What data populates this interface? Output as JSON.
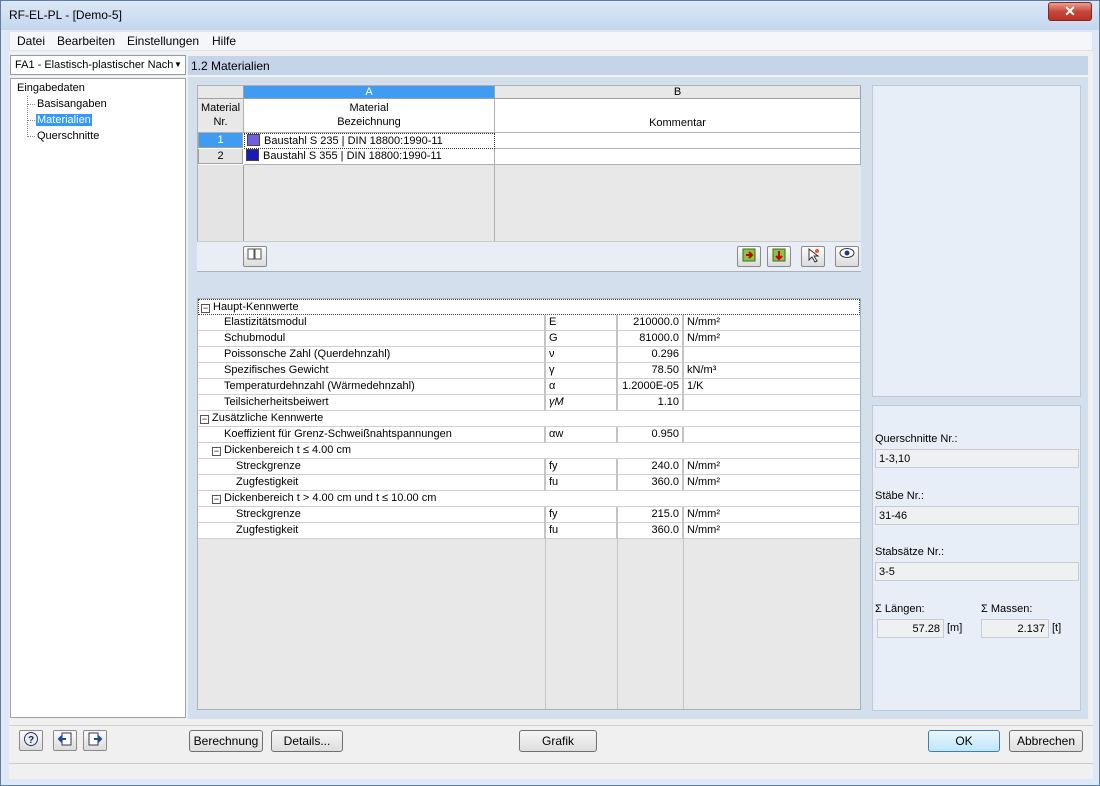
{
  "window": {
    "title": "RF-EL-PL - [Demo-5]",
    "close_glyph": "✕"
  },
  "menu": [
    "Datei",
    "Bearbeiten",
    "Einstellungen",
    "Hilfe"
  ],
  "case_select": {
    "value": "FA1 - Elastisch-plastischer Nach"
  },
  "nav": {
    "root": "Eingabedaten",
    "items": [
      "Basisangaben",
      "Materialien",
      "Querschnitte"
    ],
    "selected": "Materialien"
  },
  "section_title": "1.2 Materialien",
  "materials_table": {
    "col_letters": [
      "A",
      "B"
    ],
    "rownum_header": [
      "Material",
      "Nr."
    ],
    "col_a_header": [
      "Material",
      "Bezeichnung"
    ],
    "col_b_header": "Kommentar",
    "rows": [
      {
        "nr": "1",
        "name": "Baustahl S 235 | DIN 18800:1990-11",
        "color": "#6f5fe0",
        "comment": ""
      },
      {
        "nr": "2",
        "name": "Baustahl S 355 | DIN 18800:1990-11",
        "color": "#1a1ab4",
        "comment": ""
      }
    ],
    "toolbar_icons": [
      "library-icon",
      "import-icon",
      "export-icon",
      "pick-icon",
      "view-icon"
    ]
  },
  "properties": {
    "groups": [
      {
        "title": "Haupt-Kennwerte",
        "rows": [
          {
            "label": "Elastizitätsmodul",
            "symbol": "E",
            "value": "210000.0",
            "unit": "N/mm²"
          },
          {
            "label": "Schubmodul",
            "symbol": "G",
            "value": "81000.0",
            "unit": "N/mm²"
          },
          {
            "label": "Poissonsche Zahl (Querdehnzahl)",
            "symbol": "ν",
            "value": "0.296",
            "unit": ""
          },
          {
            "label": "Spezifisches Gewicht",
            "symbol": "γ",
            "value": "78.50",
            "unit": "kN/m³"
          },
          {
            "label": "Temperaturdehnzahl (Wärmedehnzahl)",
            "symbol": "α",
            "value": "1.2000E-05",
            "unit": "1/K"
          },
          {
            "label": "Teilsicherheitsbeiwert",
            "symbol": "γM",
            "value": "1.10",
            "unit": ""
          }
        ]
      },
      {
        "title": "Zusätzliche Kennwerte",
        "rows": [
          {
            "label": "Koeffizient für Grenz-Schweißnahtspannungen",
            "symbol": "αw",
            "value": "0.950",
            "unit": ""
          }
        ],
        "subgroups": [
          {
            "title": "Dickenbereich t ≤ 4.00 cm",
            "rows": [
              {
                "label": "Streckgrenze",
                "symbol": "fy",
                "value": "240.0",
                "unit": "N/mm²"
              },
              {
                "label": "Zugfestigkeit",
                "symbol": "fu",
                "value": "360.0",
                "unit": "N/mm²"
              }
            ]
          },
          {
            "title": "Dickenbereich t > 4.00 cm und t ≤ 10.00 cm",
            "rows": [
              {
                "label": "Streckgrenze",
                "symbol": "fy",
                "value": "215.0",
                "unit": "N/mm²"
              },
              {
                "label": "Zugfestigkeit",
                "symbol": "fu",
                "value": "360.0",
                "unit": "N/mm²"
              }
            ]
          }
        ]
      }
    ]
  },
  "info": {
    "querschnitte_label": "Querschnitte Nr.:",
    "querschnitte_value": "1-3,10",
    "staebe_label": "Stäbe Nr.:",
    "staebe_value": "31-46",
    "stabsaetze_label": "Stabsätze Nr.:",
    "stabsaetze_value": "3-5",
    "laengen_label": "Σ Längen:",
    "laengen_value": "57.28",
    "laengen_unit": "[m]",
    "massen_label": "Σ Massen:",
    "massen_value": "2.137",
    "massen_unit": "[t]"
  },
  "buttons": {
    "berechnung": "Berechnung",
    "details": "Details...",
    "grafik": "Grafik",
    "ok": "OK",
    "abbrechen": "Abbrechen"
  }
}
